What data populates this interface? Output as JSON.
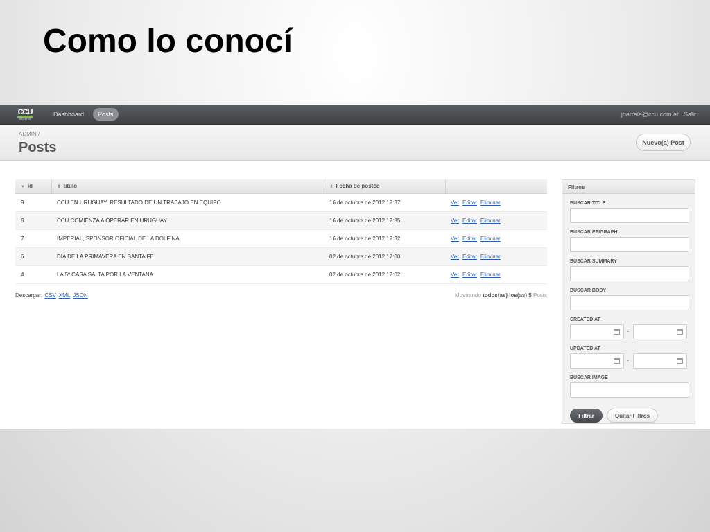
{
  "slide": {
    "title": "Como lo conocí"
  },
  "topbar": {
    "logo_text": "CCU",
    "logo_sub": "ARGENTINA",
    "nav": [
      {
        "label": "Dashboard",
        "active": false
      },
      {
        "label": "Posts",
        "active": true
      }
    ],
    "user_email": "jbarrale@ccu.com.ar",
    "logout_label": "Salir"
  },
  "header": {
    "breadcrumb": "ADMIN /",
    "title": "Posts",
    "new_button": "Nuevo(a) Post"
  },
  "table": {
    "columns": [
      "id",
      "título",
      "Fecha de posteo",
      ""
    ],
    "rows": [
      {
        "id": "9",
        "titulo": "CCU EN URUGUAY: RESULTADO DE UN TRABAJO EN EQUIPO",
        "fecha": "16 de octubre de 2012 12:37"
      },
      {
        "id": "8",
        "titulo": "CCU COMIENZA A OPERAR EN URUGUAY",
        "fecha": "16 de octubre de 2012 12:35"
      },
      {
        "id": "7",
        "titulo": "IMPERIAL, SPONSOR OFICIAL DE LA DOLFINA",
        "fecha": "16 de octubre de 2012 12:32"
      },
      {
        "id": "6",
        "titulo": "DÍA DE LA PRIMAVERA EN SANTA FE",
        "fecha": "02 de octubre de 2012 17:00"
      },
      {
        "id": "4",
        "titulo": "LA 5º CASA SALTA POR LA VENTANA",
        "fecha": "02 de octubre de 2012 17:02"
      }
    ],
    "actions": {
      "view": "Ver",
      "edit": "Editar",
      "delete": "Eliminar"
    }
  },
  "download": {
    "label": "Descargar:",
    "formats": [
      "CSV",
      "XML",
      "JSON"
    ]
  },
  "showing": {
    "prefix": "Mostrando",
    "bold": "todos(as) los(as) 5",
    "suffix": "Posts"
  },
  "filters": {
    "title": "Filtros",
    "buscar_title": "BUSCAR TITLE",
    "buscar_epigraph": "BUSCAR EPIGRAPH",
    "buscar_summary": "BUSCAR SUMMARY",
    "buscar_body": "BUSCAR BODY",
    "created_at": "CREATED AT",
    "updated_at": "UPDATED AT",
    "buscar_image": "BUSCAR IMAGE",
    "range_separator": "-",
    "filter_button": "Filtrar",
    "clear_button": "Quitar Filtros"
  }
}
